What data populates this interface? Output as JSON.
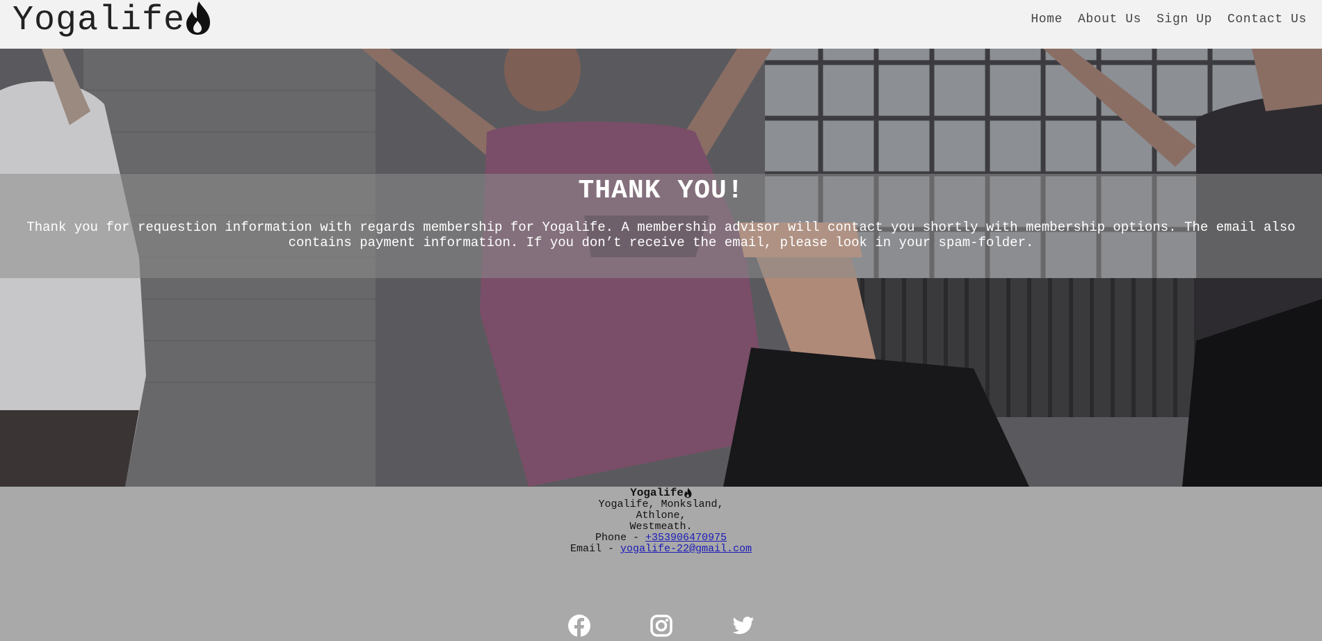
{
  "header": {
    "brand": "Yogalife",
    "nav": [
      {
        "label": "Home"
      },
      {
        "label": "About Us"
      },
      {
        "label": "Sign Up"
      },
      {
        "label": "Contact Us"
      }
    ]
  },
  "hero": {
    "title": "THANK YOU!",
    "message": "Thank you for requestion information with regards membership for Yogalife. A membership advisor will contact you shortly with membership options. The email also contains payment information. If you don’t receive the email, please look in your spam-folder."
  },
  "footer": {
    "brand": "Yogalife",
    "address": [
      "Yogalife, Monksland,",
      "Athlone,",
      "Westmeath."
    ],
    "phone_label": "Phone - ",
    "phone": "+353906470975",
    "email_label": "Email - ",
    "email": "yogalife-22@gmail.com",
    "social_icons": [
      "facebook-icon",
      "instagram-icon",
      "twitter-icon"
    ]
  },
  "colors": {
    "header_bg": "#f2f2f2",
    "footer_bg": "#a9a9a9",
    "link": "#1a1ab8",
    "band": "rgba(140,140,140,0.55)"
  }
}
